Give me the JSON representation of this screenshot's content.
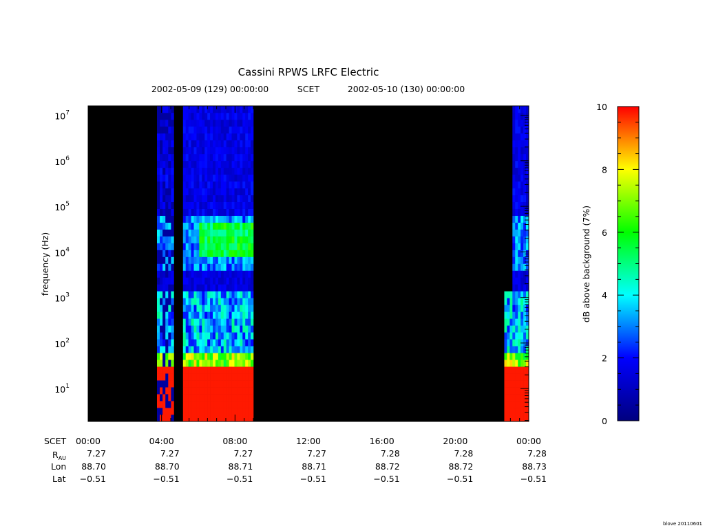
{
  "header": {
    "title": "Cassini RPWS LRFC Electric",
    "start_time": "2002-05-09 (129) 00:00:00",
    "frame": "SCET",
    "end_time": "2002-05-10 (130) 00:00:00"
  },
  "version_stamp": "blove 20110601",
  "colors": {
    "background": "#000000",
    "colorbar_stops": [
      "#00007f",
      "#0000ff",
      "#00ffff",
      "#00ff00",
      "#ffff00",
      "#ff0000"
    ]
  },
  "chart_data": {
    "type": "heatmap",
    "title": "Cassini RPWS LRFC Electric",
    "ylabel": "frequency (Hz)",
    "yscale": "log",
    "y_tick_labels": [
      {
        "base": "10",
        "exp": "1",
        "value": 10
      },
      {
        "base": "10",
        "exp": "2",
        "value": 100
      },
      {
        "base": "10",
        "exp": "3",
        "value": 1000
      },
      {
        "base": "10",
        "exp": "4",
        "value": 10000
      },
      {
        "base": "10",
        "exp": "5",
        "value": 100000
      },
      {
        "base": "10",
        "exp": "6",
        "value": 1000000
      },
      {
        "base": "10",
        "exp": "7",
        "value": 10000000
      }
    ],
    "ylim": [
      1.9,
      16000000
    ],
    "xlim": [
      "2002-05-09T00:00",
      "2002-05-10T00:00"
    ],
    "x_ticks": [
      "00:00",
      "04:00",
      "08:00",
      "12:00",
      "16:00",
      "20:00",
      "00:00"
    ],
    "ephemeris": {
      "labels": {
        "time": "SCET",
        "r_base": "R",
        "r_sub": "AU",
        "lon": "Lon",
        "lat": "Lat"
      },
      "r_au": [
        "7.27",
        "7.27",
        "7.27",
        "7.27",
        "7.28",
        "7.28",
        "7.28"
      ],
      "lon": [
        "88.70",
        "88.70",
        "88.71",
        "88.71",
        "88.72",
        "88.72",
        "88.73"
      ],
      "lat": [
        "−0.51",
        "−0.51",
        "−0.51",
        "−0.51",
        "−0.51",
        "−0.51",
        "−0.51"
      ]
    },
    "data_intervals": [
      {
        "start": "03:45",
        "end": "04:40"
      },
      {
        "start": "05:10",
        "end": "09:00"
      },
      {
        "start": "22:40",
        "end": "24:00"
      }
    ],
    "colorbar": {
      "label": "dB above background (7%)",
      "range": [
        0,
        10
      ],
      "ticks": [
        "0",
        "2",
        "4",
        "6",
        "8",
        "10"
      ]
    }
  }
}
